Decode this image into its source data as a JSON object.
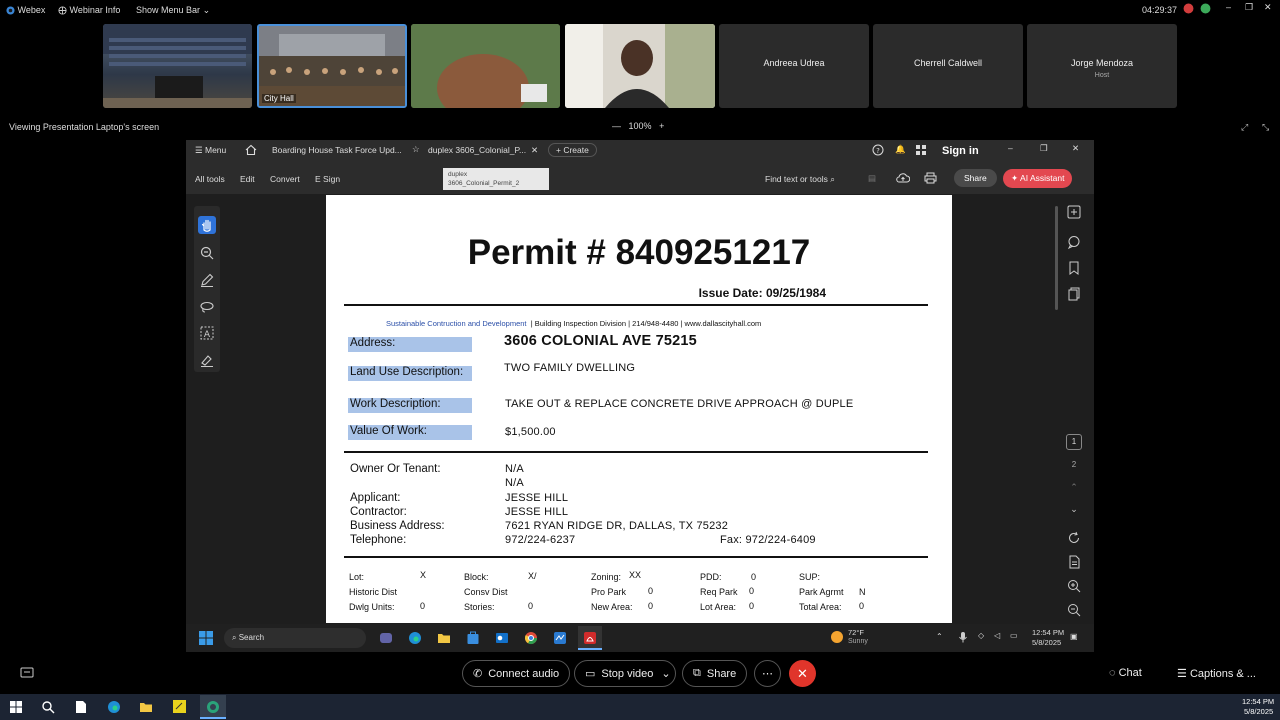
{
  "webex": {
    "app": "Webex",
    "webinar_info": "Webinar Info",
    "show_menu_bar": "Show Menu Bar",
    "clock": "04:29:37",
    "viewing": "Viewing Presentation Laptop's screen",
    "zoom": "100%",
    "participants": [
      {
        "name": "Andreea Udrea",
        "sub": ""
      },
      {
        "name": "Cherrell Caldwell",
        "sub": ""
      },
      {
        "name": "Jorge Mendoza",
        "sub": "Host"
      }
    ],
    "tile_city_hall": "City Hall",
    "controls": {
      "connect_audio": "Connect audio",
      "stop_video": "Stop video",
      "share": "Share",
      "chat": "Chat",
      "captions": "Captions & ..."
    }
  },
  "acrobat": {
    "menu": "Menu",
    "tabs": [
      "Boarding House Task Force Upd...",
      "duplex 3606_Colonial_P..."
    ],
    "create": "Create",
    "tooltip_1": "duplex",
    "tooltip_2": "3606_Colonial_Permit_2",
    "sign_in": "Sign in",
    "toolbar": [
      "All tools",
      "Edit",
      "Convert",
      "E Sign"
    ],
    "find": "Find text or tools",
    "share": "Share",
    "ai_assistant": "AI Assistant",
    "page_num": "1",
    "page_total": "2"
  },
  "document": {
    "title": "Permit # 8409251217",
    "issue_date": "Issue Date: 09/25/1984",
    "org_blue": "Sustainable Contruction and Development",
    "org_rest": "| Building Inspection Division |  214/948-4480 | www.dallascityhall.com",
    "address_label": "Address:",
    "address": "3606 COLONIAL AVE 75215",
    "land_use_label": "Land Use Description:",
    "land_use": "TWO FAMILY DWELLING",
    "work_label": "Work Description:",
    "work": "TAKE OUT & REPLACE CONCRETE DRIVE APPROACH @ DUPLE",
    "value_label": "Value Of Work:",
    "value": "$1,500.00",
    "owner_label": "Owner Or Tenant:",
    "owner_1": "N/A",
    "owner_2": "N/A",
    "applicant_label": "Applicant:",
    "applicant": "JESSE HILL",
    "contractor_label": "Contractor:",
    "contractor": "JESSE HILL",
    "business_label": "Business Address:",
    "business": "7621 RYAN RIDGE DR, DALLAS, TX 75232",
    "telephone_label": "Telephone:",
    "telephone": "972/224-6237",
    "fax": "Fax:  972/224-6409",
    "grid": {
      "lot_l": "Lot:",
      "lot_v": "X",
      "block_l": "Block:",
      "block_v": "X/",
      "zoning_l": "Zoning:",
      "zoning_v": "XX",
      "pdd_l": "PDD:",
      "pdd_v": "0",
      "sup_l": "SUP:",
      "hist_l": "Historic Dist",
      "consv_l": "Consv Dist",
      "propark_l": "Pro Park",
      "propark_v": "0",
      "reqpark_l": "Req Park",
      "reqpark_v": "0",
      "parkagmt_l": "Park Agrmt",
      "parkagmt_v": "N",
      "dwlg_l": "Dwlg Units:",
      "dwlg_v": "0",
      "stories_l": "Stories:",
      "stories_v": "0",
      "newarea_l": "New Area:",
      "newarea_v": "0",
      "lotarea_l": "Lot Area:",
      "lotarea_v": "0",
      "totarea_l": "Total Area:",
      "totarea_v": "0"
    }
  },
  "inner_taskbar": {
    "search": "Search",
    "weather_temp": "72°F",
    "weather_desc": "Sunny",
    "time": "12:54 PM",
    "date": "5/8/2025"
  },
  "host_taskbar": {
    "time": "12:54 PM",
    "date": "5/8/2025"
  },
  "colors": {
    "ai_assistant": "#e34850",
    "highlight": "#a9c3e8",
    "leave": "#e0352b",
    "hand_tool": "#2f73d9"
  }
}
